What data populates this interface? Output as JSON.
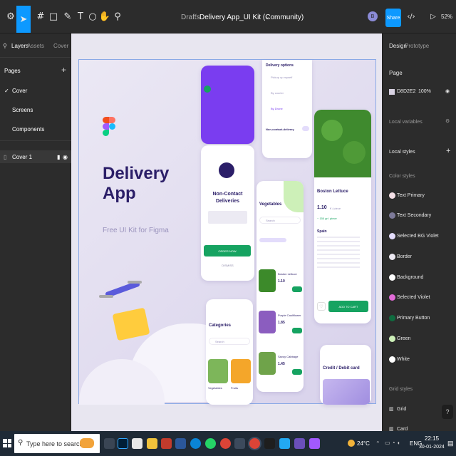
{
  "topbar": {
    "breadcrumb_root": "Drafts",
    "file_name": "Delivery App_UI Kit (Community)",
    "avatar_initial": "B",
    "share_label": "Share",
    "zoom": "52%"
  },
  "left_panel": {
    "tab_layers": "Layers",
    "tab_assets": "Assets",
    "page_selector": "Cover",
    "pages_heading": "Pages",
    "pages": [
      "Cover",
      "Screens",
      "Components"
    ],
    "layer": "Cover 1"
  },
  "right_panel": {
    "tab_design": "Design",
    "tab_prototype": "Prototype",
    "page_heading": "Page",
    "bg_hex": "D8D2E2",
    "bg_opacity": "100%",
    "local_variables": "Local variables",
    "local_styles": "Local styles",
    "color_styles_heading": "Color styles",
    "color_styles": [
      {
        "name": "Text Primary",
        "color": "#f3dfe6"
      },
      {
        "name": "Text Secondary",
        "color": "#7d7a99"
      },
      {
        "name": "Selected BG Violet",
        "color": "#e3dcfb"
      },
      {
        "name": "Border",
        "color": "#ece9f2"
      },
      {
        "name": "Background",
        "color": "#ffffff"
      },
      {
        "name": "Selected Violet",
        "color": "#e26bd8"
      },
      {
        "name": "Primary Button",
        "color": "#0f6b3f"
      },
      {
        "name": "Green",
        "color": "#cdf0b8"
      },
      {
        "name": "White",
        "color": "#ffffff"
      }
    ],
    "grid_styles_heading": "Grid styles",
    "grid_styles": [
      "Grid",
      "Card"
    ]
  },
  "cover": {
    "title_line1": "Delivery",
    "title_line2": "App",
    "subtitle": "Free UI Kit for Figma",
    "brand_violet": "#2b1e68",
    "accent_green": "#16a361",
    "delivery_options_title": "Delivery options",
    "option_1": "Pickup up myself",
    "option_2": "By courier",
    "option_3": "By Drone",
    "non_contact_delivery": "Non-contact-delivery",
    "non_contact_title_1": "Non-Contact",
    "non_contact_title_2": "Deliveries",
    "order_now": "ORDER NOW",
    "dismiss": "DISMISS",
    "vegetables_title": "Vegetables",
    "search": "Search",
    "product_1": "Boston Lettuce",
    "product_1_price": "1.10",
    "product_2": "Purple Cauliflower",
    "product_2_price": "1.85",
    "product_3": "Savoy Cabbage",
    "product_3_price": "1.45",
    "detail_title": "Boston Lettuce",
    "detail_price": "1.10",
    "detail_unit": "€ / piece",
    "detail_weight": "~ 150 gr / piece",
    "detail_origin": "Spain",
    "add_to_cart": "ADD TO CART",
    "categories_title": "Categories",
    "category_1": "Vegetables",
    "category_2": "Fruits",
    "credit_title": "Credit / Debit card"
  },
  "taskbar": {
    "search_placeholder": "Type here to search",
    "weather": "24°C",
    "language": "ENG",
    "time": "22:15",
    "date": "30-01-2024"
  }
}
